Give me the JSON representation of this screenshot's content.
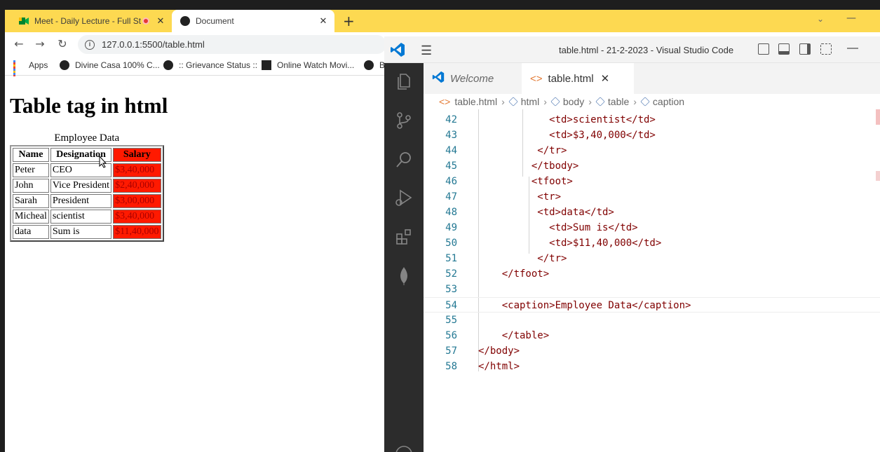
{
  "browser": {
    "tabs": [
      {
        "title": "Meet - Daily Lecture - Full St",
        "recording": true
      },
      {
        "title": "Document",
        "active": true
      }
    ],
    "new_tab": "+",
    "address": "127.0.0.1:5500/table.html",
    "bookmarks": [
      "Apps",
      "Divine Casa 100% C...",
      ":: Grievance Status ::",
      "Online Watch Movi...",
      "B"
    ]
  },
  "page": {
    "heading": "Table tag in html",
    "table": {
      "caption": "Employee Data",
      "headers": [
        "Name",
        "Designation",
        "Salary"
      ],
      "rows": [
        [
          "Peter",
          "CEO",
          "$3,40,000"
        ],
        [
          "John",
          "Vice President",
          "$2,40,000"
        ],
        [
          "Sarah",
          "President",
          "$3,00,000"
        ],
        [
          "Micheal",
          "scientist",
          "$3,40,000"
        ],
        [
          "data",
          "Sum is",
          "$11,40,000"
        ]
      ],
      "salary_color": "#ff1a00"
    }
  },
  "vscode": {
    "title": "table.html - 21-2-2023 - Visual Studio Code",
    "tabs": [
      {
        "label": "Welcome"
      },
      {
        "label": "table.html",
        "active": true
      }
    ],
    "breadcrumb": [
      "table.html",
      "html",
      "body",
      "table",
      "caption"
    ],
    "lines": [
      {
        "n": "42",
        "text": "            <td>scientist</td>"
      },
      {
        "n": "43",
        "text": "            <td>$3,40,000</td>"
      },
      {
        "n": "44",
        "text": "          </tr>"
      },
      {
        "n": "45",
        "text": "         </tbody>"
      },
      {
        "n": "46",
        "text": "         <tfoot>"
      },
      {
        "n": "47",
        "text": "          <tr>"
      },
      {
        "n": "48",
        "text": "          <td>data</td>"
      },
      {
        "n": "49",
        "text": "            <td>Sum is</td>"
      },
      {
        "n": "50",
        "text": "            <td>$11,40,000</td>"
      },
      {
        "n": "51",
        "text": "          </tr>"
      },
      {
        "n": "52",
        "text": "    </tfoot>"
      },
      {
        "n": "53",
        "text": ""
      },
      {
        "n": "54",
        "text": "    <caption>Employee Data</caption>"
      },
      {
        "n": "55",
        "text": ""
      },
      {
        "n": "56",
        "text": "    </table>"
      },
      {
        "n": "57",
        "text": "</body>"
      },
      {
        "n": "58",
        "text": "</html>"
      }
    ],
    "active_line": "54"
  }
}
